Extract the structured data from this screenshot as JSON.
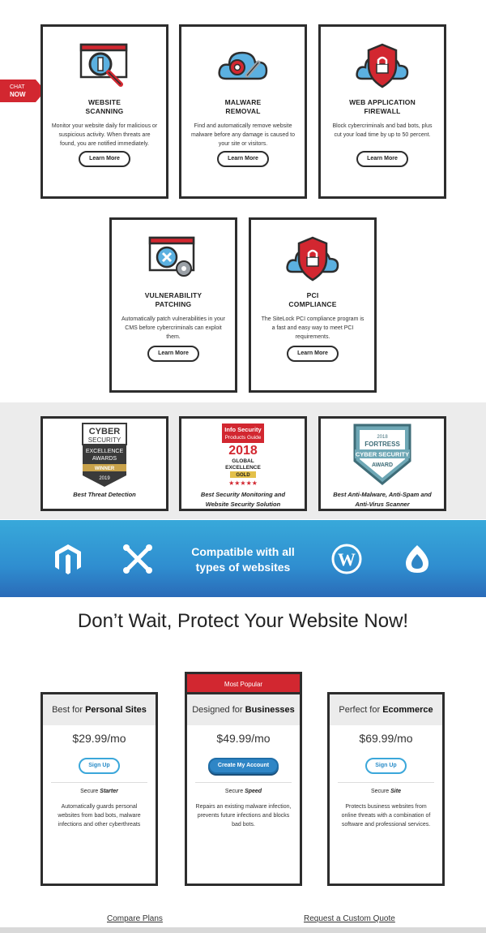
{
  "chat": {
    "line1": "CHAT",
    "line2": "NOW"
  },
  "services": [
    {
      "title1": "WEBSITE",
      "title2": "SCANNING",
      "desc": "Monitor your website daily for malicious or suspicious activity. When threats are found, you are notified immediately.",
      "cta": "Learn More",
      "icon": "magnifier-browser-icon"
    },
    {
      "title1": "MALWARE",
      "title2": "REMOVAL",
      "desc": "Find and automatically remove website malware before any damage is caused to your site or visitors.",
      "cta": "Learn More",
      "icon": "cloud-wrench-icon"
    },
    {
      "title1": "WEB APPLICATION",
      "title2": "FIREWALL",
      "desc": "Block cybercriminals and bad bots, plus cut your load time by up to 50 percent.",
      "cta": "Learn More",
      "icon": "shield-lock-icon"
    },
    {
      "title1": "VULNERABILITY",
      "title2": "PATCHING",
      "desc": "Automatically patch vulnerabilities in your CMS before cybercriminals can exploit them.",
      "cta": "Learn More",
      "icon": "browser-gear-icon"
    },
    {
      "title1": "PCI",
      "title2": "COMPLIANCE",
      "desc": "The SiteLock PCI compliance program is a fast and easy way to meet PCI requirements.",
      "cta": "Learn More",
      "icon": "shield-lock-icon"
    }
  ],
  "awards": [
    {
      "l1": "CYBER",
      "l2": "SECURITY",
      "l3": "EXCELLENCE",
      "l4": "AWARDS",
      "l5": "WINNER",
      "l6": "2019",
      "caption1": "Best Threat Detection",
      "caption2": ""
    },
    {
      "l1": "Info Security",
      "l2": "Products Guide",
      "l3": "2018",
      "l4": "GLOBAL",
      "l5": "EXCELLENCE",
      "l6": "GOLD",
      "caption1": "Best Security Monitoring and",
      "caption2": "Website Security Solution"
    },
    {
      "l1": "2018",
      "l2": "FORTRESS",
      "l3": "CYBER SECURITY",
      "l4": "AWARD",
      "caption1": "Best Anti-Malware, Anti-Spam and",
      "caption2": "Anti-Virus Scanner"
    }
  ],
  "compat": {
    "line1": "Compatible with all",
    "line2": "types of websites",
    "icons": [
      "magento-icon",
      "joomla-icon",
      "wordpress-icon",
      "drupal-icon"
    ]
  },
  "headline": "Don’t Wait, Protect Your Website Now!",
  "popular_label": "Most Popular",
  "plans": [
    {
      "pre": "Best for",
      "bold": "Personal Sites",
      "price": "$29.99/mo",
      "cta": "Sign Up",
      "tier_pre": "Secure",
      "tier": "Starter",
      "desc": "Automatically guards personal websites from bad bots, malware infections and other cyberthreats"
    },
    {
      "pre": "Designed for",
      "bold": "Businesses",
      "price": "$49.99/mo",
      "cta": "Create My Account",
      "tier_pre": "Secure",
      "tier": "Speed",
      "desc": "Repairs an existing malware infection, prevents future infections and blocks bad bots."
    },
    {
      "pre": "Perfect for",
      "bold": "Ecommerce",
      "price": "$69.99/mo",
      "cta": "Sign Up",
      "tier_pre": "Secure",
      "tier": "Site",
      "desc": "Protects business websites from online threats with a combination of software and professional services."
    }
  ],
  "links": {
    "compare": "Compare Plans",
    "quote": "Request a Custom Quote"
  },
  "colors": {
    "accent_red": "#d22730",
    "accent_blue": "#2f86c6",
    "cloud_blue": "#5bb0e0"
  }
}
